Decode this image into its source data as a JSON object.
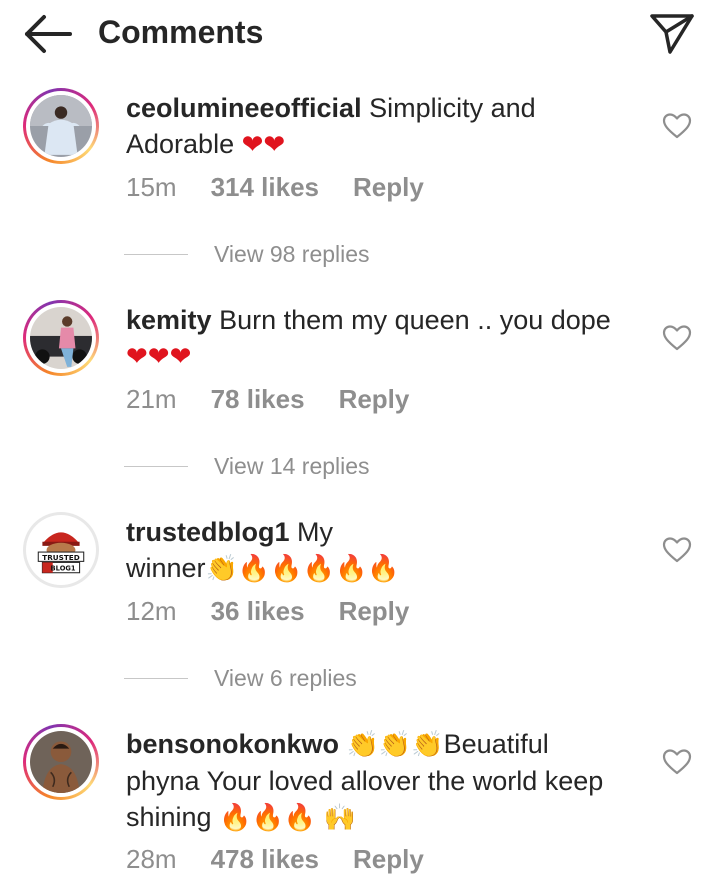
{
  "header": {
    "title": "Comments",
    "back_icon": "arrow-left-icon",
    "share_icon": "paper-plane-icon"
  },
  "colors": {
    "text": "#262626",
    "muted": "#8e8e8e",
    "heart": "#e0141e",
    "fire": "#f45d0c",
    "story_ring": [
      "#f58529",
      "#dd2a7b",
      "#8134af"
    ]
  },
  "comments": [
    {
      "username": "ceolumineeofficial",
      "text_line1": " Simplicity and",
      "text_line2": "Adorable ",
      "emojis": "❤❤",
      "time": "15m",
      "likes": "314 likes",
      "reply": "Reply",
      "view_replies": "View 98 replies"
    },
    {
      "username": "kemity",
      "text_line1": " Burn them  my queen .. you dope",
      "emojis": "❤❤❤",
      "time": "21m",
      "likes": "78 likes",
      "reply": "Reply",
      "view_replies": "View 14 replies"
    },
    {
      "username": "trustedblog1",
      "text_line1": " My",
      "text_line2": "winner",
      "emojis_clap": "👏",
      "emojis_fire": "🔥🔥🔥🔥🔥",
      "time": "12m",
      "likes": "36 likes",
      "reply": "Reply",
      "view_replies": "View 6 replies",
      "avatar_text_1": "TRUSTED",
      "avatar_text_2": "BLOG1"
    },
    {
      "username": "bensonokonkwo",
      "emojis_clap": "👏👏👏",
      "text_line1": "Beuatiful",
      "text_line2": "phyna Your loved allover the world keep",
      "text_line3": "shining ",
      "emojis_fire": "🔥🔥🔥",
      "emojis_raise": "🙌",
      "time": "28m",
      "likes": "478 likes",
      "reply": "Reply"
    }
  ]
}
